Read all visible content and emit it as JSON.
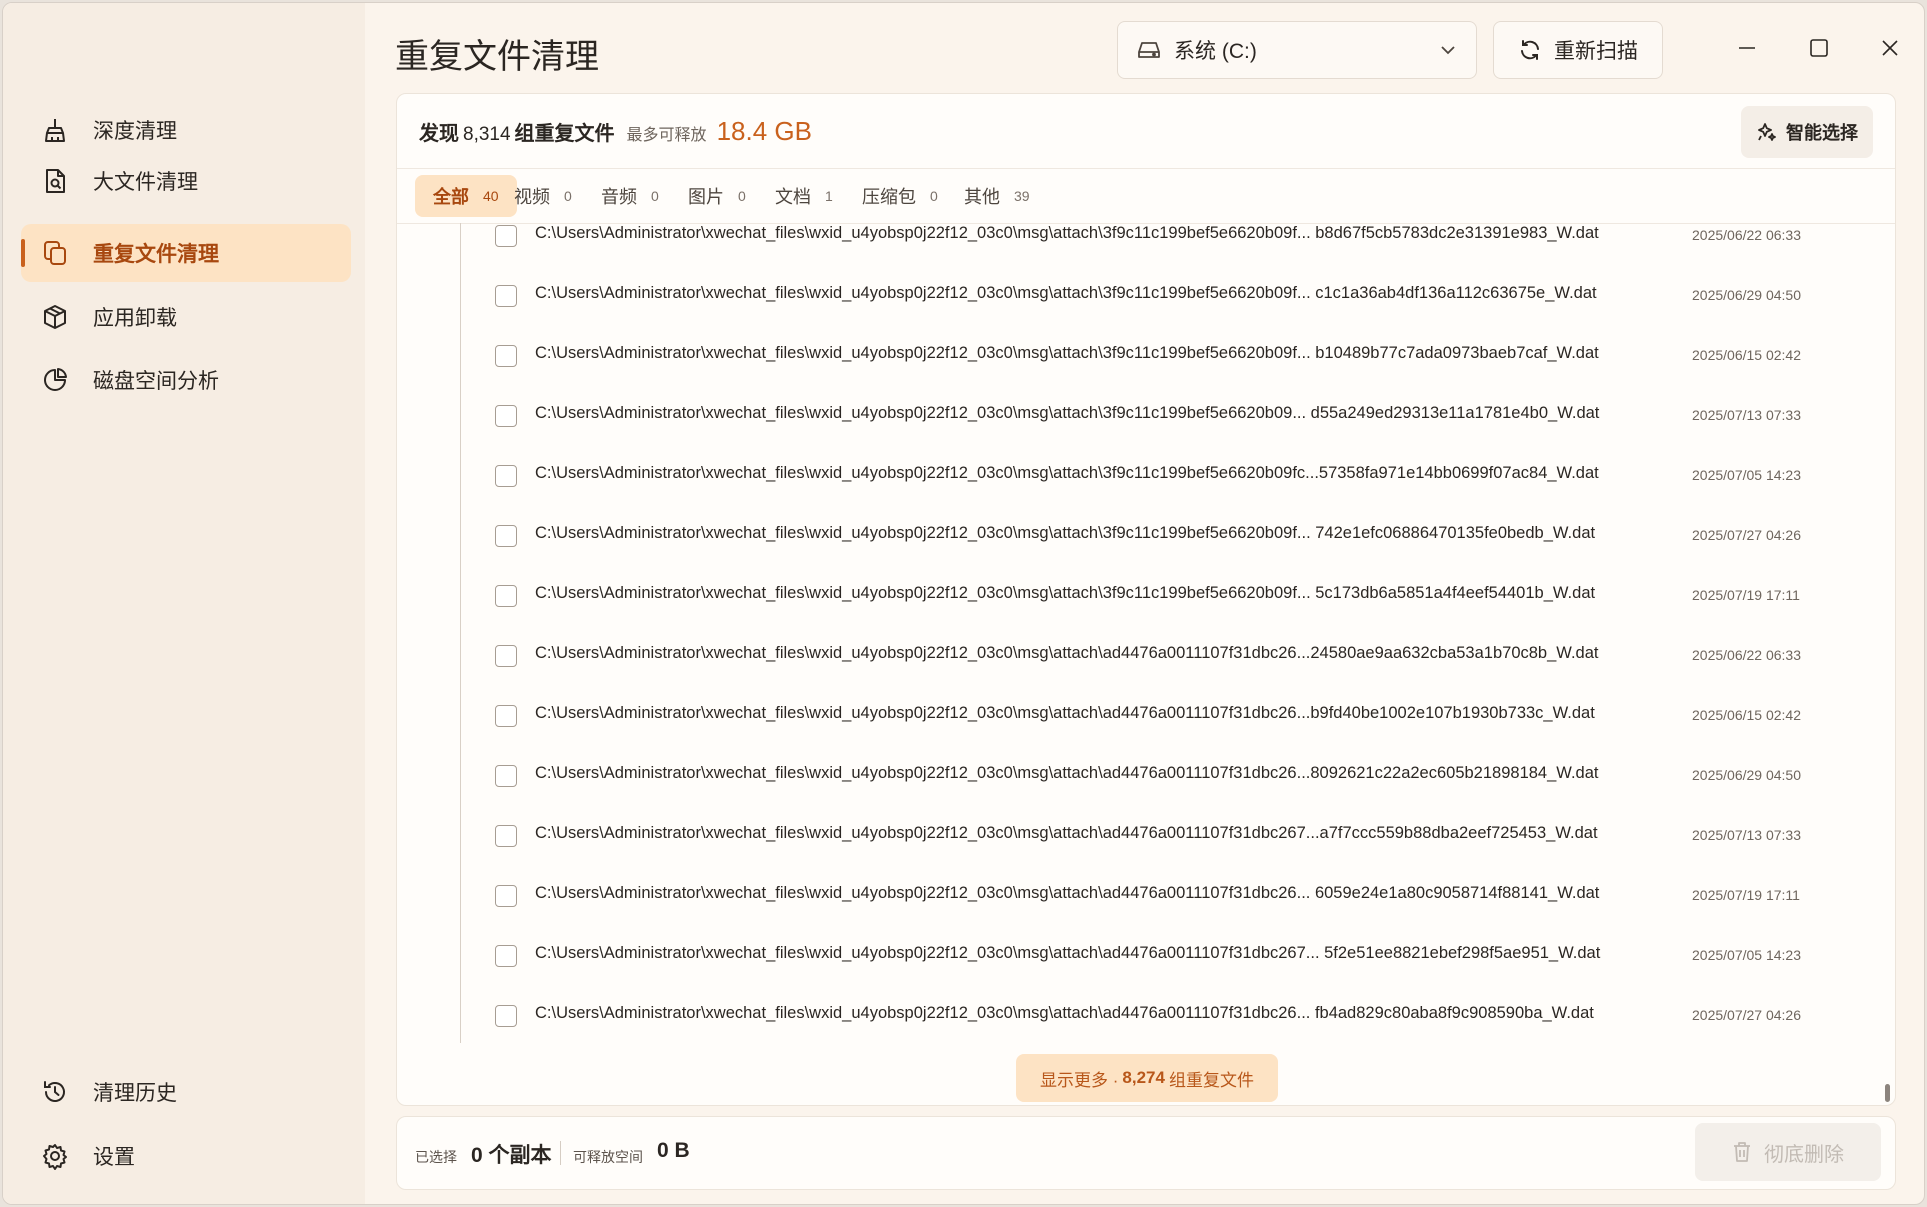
{
  "window": {
    "title": "重复文件清理"
  },
  "sidebar": {
    "items": [
      {
        "label": "深度清理",
        "icon": "broom-icon"
      },
      {
        "label": "大文件清理",
        "icon": "file-search-icon"
      },
      {
        "label": "重复文件清理",
        "icon": "copy-icon",
        "active": true
      },
      {
        "label": "应用卸载",
        "icon": "package-icon"
      },
      {
        "label": "磁盘空间分析",
        "icon": "pie-chart-icon"
      }
    ],
    "bottom": [
      {
        "label": "清理历史",
        "icon": "history-icon"
      },
      {
        "label": "设置",
        "icon": "gear-icon"
      }
    ]
  },
  "header": {
    "drive": "系统 (C:)",
    "rescan": "重新扫描"
  },
  "summary": {
    "found": "发现",
    "groups": "8,314",
    "groups_suffix": "组重复文件",
    "max_free_label": "最多可释放",
    "max_free_value": "18.4 GB",
    "smart_select": "智能选择"
  },
  "tabs": [
    {
      "label": "全部",
      "count": "40"
    },
    {
      "label": "视频",
      "count": "0"
    },
    {
      "label": "音频",
      "count": "0"
    },
    {
      "label": "图片",
      "count": "0"
    },
    {
      "label": "文档",
      "count": "1"
    },
    {
      "label": "压缩包",
      "count": "0"
    },
    {
      "label": "其他",
      "count": "39"
    }
  ],
  "files": [
    {
      "path": "C:\\Users\\Administrator\\xwechat_files\\wxid_u4yobsp0j22f12_03c0\\msg\\attach\\3f9c11c199bef5e6620b09f... b8d67f5cb5783dc2e31391e983_W.dat",
      "date": "2025/06/22 06:33"
    },
    {
      "path": "C:\\Users\\Administrator\\xwechat_files\\wxid_u4yobsp0j22f12_03c0\\msg\\attach\\3f9c11c199bef5e6620b09f... c1c1a36ab4df136a112c63675e_W.dat",
      "date": "2025/06/29 04:50"
    },
    {
      "path": "C:\\Users\\Administrator\\xwechat_files\\wxid_u4yobsp0j22f12_03c0\\msg\\attach\\3f9c11c199bef5e6620b09f... b10489b77c7ada0973baeb7caf_W.dat",
      "date": "2025/06/15 02:42"
    },
    {
      "path": "C:\\Users\\Administrator\\xwechat_files\\wxid_u4yobsp0j22f12_03c0\\msg\\attach\\3f9c11c199bef5e6620b09... d55a249ed29313e11a1781e4b0_W.dat",
      "date": "2025/07/13 07:33"
    },
    {
      "path": "C:\\Users\\Administrator\\xwechat_files\\wxid_u4yobsp0j22f12_03c0\\msg\\attach\\3f9c11c199bef5e6620b09fc...57358fa971e14bb0699f07ac84_W.dat",
      "date": "2025/07/05 14:23"
    },
    {
      "path": "C:\\Users\\Administrator\\xwechat_files\\wxid_u4yobsp0j22f12_03c0\\msg\\attach\\3f9c11c199bef5e6620b09f... 742e1efc06886470135fe0bedb_W.dat",
      "date": "2025/07/27 04:26"
    },
    {
      "path": "C:\\Users\\Administrator\\xwechat_files\\wxid_u4yobsp0j22f12_03c0\\msg\\attach\\3f9c11c199bef5e6620b09f... 5c173db6a5851a4f4eef54401b_W.dat",
      "date": "2025/07/19 17:11"
    },
    {
      "path": "C:\\Users\\Administrator\\xwechat_files\\wxid_u4yobsp0j22f12_03c0\\msg\\attach\\ad4476a0011107f31dbc26...24580ae9aa632cba53a1b70c8b_W.dat",
      "date": "2025/06/22 06:33"
    },
    {
      "path": "C:\\Users\\Administrator\\xwechat_files\\wxid_u4yobsp0j22f12_03c0\\msg\\attach\\ad4476a0011107f31dbc26...b9fd40be1002e107b1930b733c_W.dat",
      "date": "2025/06/15 02:42"
    },
    {
      "path": "C:\\Users\\Administrator\\xwechat_files\\wxid_u4yobsp0j22f12_03c0\\msg\\attach\\ad4476a0011107f31dbc26...8092621c22a2ec605b21898184_W.dat",
      "date": "2025/06/29 04:50"
    },
    {
      "path": "C:\\Users\\Administrator\\xwechat_files\\wxid_u4yobsp0j22f12_03c0\\msg\\attach\\ad4476a0011107f31dbc267...a7f7ccc559b88dba2eef725453_W.dat",
      "date": "2025/07/13 07:33"
    },
    {
      "path": "C:\\Users\\Administrator\\xwechat_files\\wxid_u4yobsp0j22f12_03c0\\msg\\attach\\ad4476a0011107f31dbc26... 6059e24e1a80c9058714f88141_W.dat",
      "date": "2025/07/19 17:11"
    },
    {
      "path": "C:\\Users\\Administrator\\xwechat_files\\wxid_u4yobsp0j22f12_03c0\\msg\\attach\\ad4476a0011107f31dbc267... 5f2e51ee8821ebef298f5ae951_W.dat",
      "date": "2025/07/05 14:23"
    },
    {
      "path": "C:\\Users\\Administrator\\xwechat_files\\wxid_u4yobsp0j22f12_03c0\\msg\\attach\\ad4476a0011107f31dbc26... fb4ad829c80aba8f9c908590ba_W.dat",
      "date": "2025/07/27 04:26"
    }
  ],
  "more": {
    "prefix": "显示更多 ·",
    "count": "8,274",
    "suffix": "组重复文件"
  },
  "footer": {
    "selected_label": "已选择",
    "selected_value": "0 个副本",
    "free_label": "可释放空间",
    "free_value": "0 B",
    "delete": "彻底删除"
  },
  "colors": {
    "accent": "#c9611d",
    "accent_bg": "#fde3c4",
    "window_bg": "#fbf4ec"
  }
}
